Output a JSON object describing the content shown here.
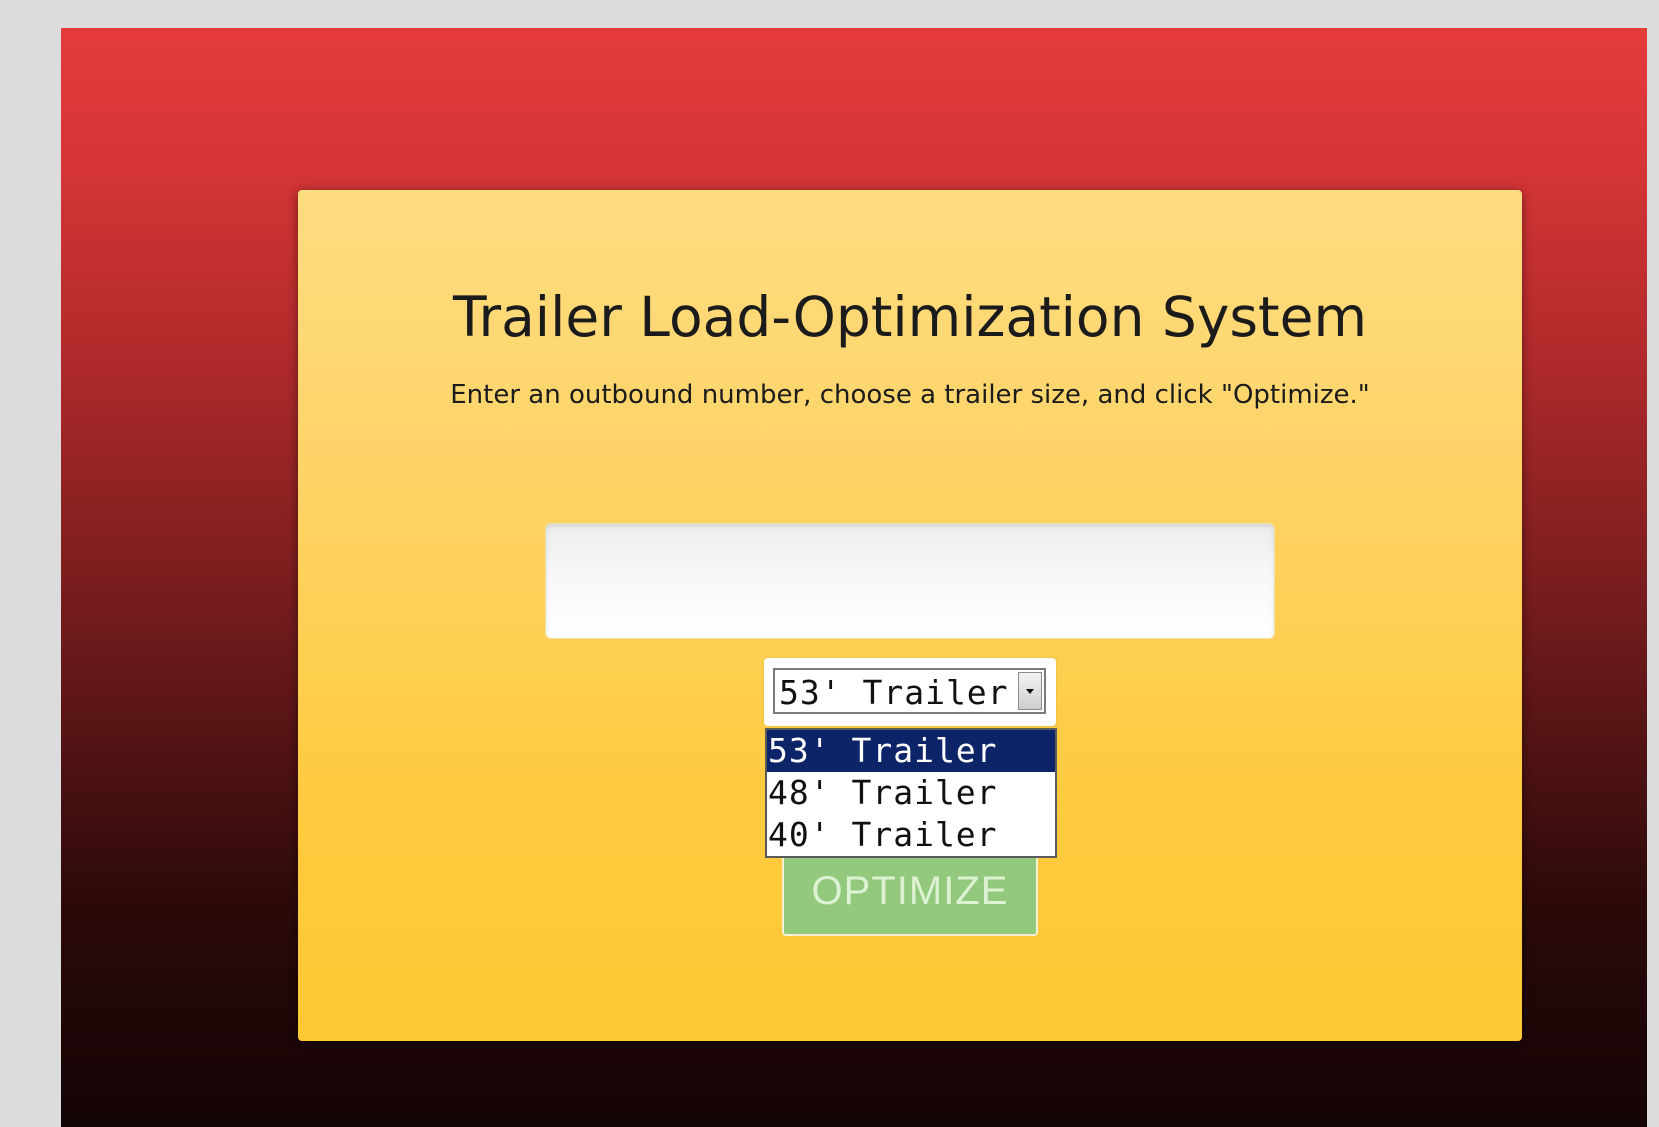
{
  "header": {
    "title": "Trailer Load-Optimization System",
    "instructions": "Enter an outbound number, choose a trailer size, and click \"Optimize.\""
  },
  "form": {
    "outbound_number": {
      "value": "",
      "placeholder": ""
    },
    "trailer_size": {
      "selected": "53' Trailer",
      "dropdown_open": true,
      "options": [
        "53' Trailer",
        "48' Trailer",
        "40' Trailer"
      ],
      "highlighted_index": 0
    },
    "optimize_button": {
      "label": "OPTIMIZE"
    }
  },
  "colors": {
    "background_top": "#e53b3b",
    "background_bottom": "#140405",
    "panel_top": "#fedd80",
    "panel_bottom": "#fec734",
    "button": "#93c97d",
    "highlight": "#0d2468"
  },
  "icons": {
    "dropdown_arrow": "chevron-down-icon"
  }
}
